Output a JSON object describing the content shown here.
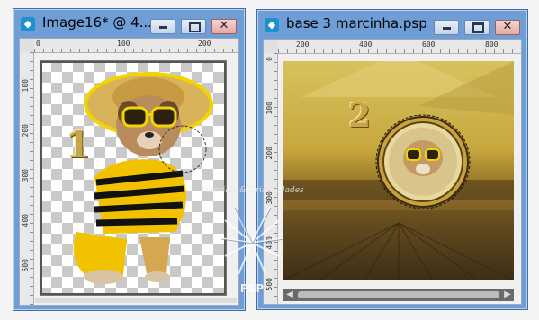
{
  "left_window": {
    "title": "Image16* @  4...",
    "number_label": "1",
    "ruler_top_ticks": [
      "0",
      "100",
      "200"
    ],
    "ruler_left_ticks": [
      "100",
      "200",
      "300",
      "400",
      "500"
    ]
  },
  "right_window": {
    "title": "base 3 marcinha.pspi...",
    "number_label": "2",
    "ruler_top_ticks": [
      "200",
      "400",
      "600",
      "800"
    ],
    "ruler_left_ticks": [
      "0",
      "100",
      "200",
      "300",
      "400",
      "500"
    ]
  },
  "window_controls": {
    "minimize_icon": "minimize-icon",
    "maximize_icon": "maximize-icon",
    "close_icon": "close-icon"
  },
  "watermark": {
    "text": "Tutoriais & Criatividades",
    "signature": "PSP"
  },
  "colors": {
    "titlebar": "#6f9ed6",
    "close_button": "#e6a9a2",
    "gold": "#c9a54a"
  }
}
